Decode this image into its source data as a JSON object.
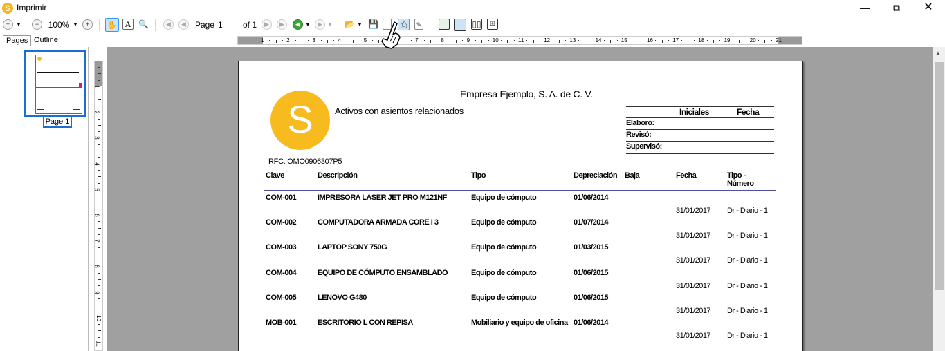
{
  "window": {
    "title": "Imprimir"
  },
  "toolbar": {
    "zoom": "100%",
    "page_label": "Page",
    "page_value": "1",
    "page_of": "of 1"
  },
  "tabs": [
    "Pages",
    "Outline"
  ],
  "thumbnail": {
    "label": "Page 1"
  },
  "ruler": {
    "h": [
      "1",
      "2",
      "3",
      "4",
      "5",
      "6",
      "7",
      "8",
      "9",
      "10",
      "11",
      "12",
      "13",
      "14",
      "15",
      "16",
      "17",
      "18",
      "19",
      "20",
      "21"
    ],
    "v": [
      "1",
      "2",
      "3",
      "4",
      "5",
      "6",
      "7",
      "8",
      "9",
      "10",
      "11"
    ]
  },
  "report": {
    "company": "Empresa Ejemplo, S. A. de C. V.",
    "title": "Activos con asientos relacionados",
    "logo_letter": "S",
    "rfc": "RFC: OMO0906307P5",
    "signature": {
      "col1": "Iniciales",
      "col2": "Fecha",
      "rows": [
        "Elaboró:",
        "Revisó:",
        "Supervisó:"
      ]
    },
    "columns": {
      "clave": "Clave",
      "descripcion": "Descripción",
      "tipo": "Tipo",
      "depreciacion": "Depreciación",
      "baja": "Baja",
      "fecha": "Fecha",
      "tipo_numero_1": "Tipo -",
      "tipo_numero_2": "Número"
    },
    "rows": [
      {
        "clave": "COM-001",
        "descripcion": "IMPRESORA LASER JET PRO M121NF",
        "tipo": "Equipo de cómputo",
        "depreciacion": "01/06/2014",
        "fecha": "31/01/2017",
        "numero": "Dr - Diario - 1"
      },
      {
        "clave": "COM-002",
        "descripcion": "COMPUTADORA ARMADA CORE I 3",
        "tipo": "Equipo de cómputo",
        "depreciacion": "01/07/2014",
        "fecha": "31/01/2017",
        "numero": "Dr - Diario - 1"
      },
      {
        "clave": "COM-003",
        "descripcion": "LAPTOP SONY 750G",
        "tipo": "Equipo de cómputo",
        "depreciacion": "01/03/2015",
        "fecha": "31/01/2017",
        "numero": "Dr - Diario - 1"
      },
      {
        "clave": "COM-004",
        "descripcion": "EQUIPO DE CÓMPUTO ENSAMBLADO",
        "tipo": "Equipo de cómputo",
        "depreciacion": "01/06/2015",
        "fecha": "31/01/2017",
        "numero": "Dr - Diario - 1"
      },
      {
        "clave": "COM-005",
        "descripcion": "LENOVO G480",
        "tipo": "Equipo de cómputo",
        "depreciacion": "01/06/2015",
        "fecha": "31/01/2017",
        "numero": "Dr - Diario - 1"
      },
      {
        "clave": "MOB-001",
        "descripcion": "ESCRITORIO L CON REPISA",
        "tipo": "Mobiliario y equipo de oficina",
        "depreciacion": "01/06/2014",
        "fecha": "31/01/2017",
        "numero": "Dr - Diario - 1"
      }
    ]
  },
  "colors": {
    "accent": "#1a6fd0",
    "logo": "#f8bb1f",
    "header_line": "#5050a0",
    "viewport": "#a0a0a0"
  }
}
